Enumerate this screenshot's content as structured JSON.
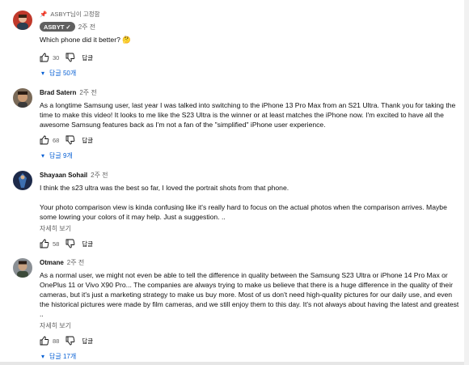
{
  "comments": [
    {
      "pinned_label": "ASBYT님이 고정함",
      "author": "ASBYT",
      "time": "2주 전",
      "text": "Which phone did it better? 🤔",
      "likes": "30",
      "reply_label": "답글",
      "replies_label": "답글 50개"
    },
    {
      "author": "Brad Satern",
      "time": "2주 전",
      "text": "As a longtime Samsung user, last year I was talked into switching to the iPhone 13 Pro Max from an S21 Ultra. Thank you for taking the time to make this video! It looks to me like the S23 Ultra is the winner or at least matches the iPhone now. I'm excited to have all the awesome Samsung features back as I'm not a fan of the \"simplified\" iPhone user experience.",
      "likes": "68",
      "reply_label": "답글",
      "replies_label": "답글 9개"
    },
    {
      "author": "Shayaan Sohail",
      "time": "2주 전",
      "text": "I think the s23 ultra was the best so far, I loved the portrait shots from that phone.\n\nYour photo comparison view is kinda confusing like it's really hard to focus on the actual photos when the comparison arrives. Maybe some lowring your colors of it may help. Just a suggestion. ..",
      "more_label": "자세히 보기",
      "likes": "58",
      "reply_label": "답글"
    },
    {
      "author": "Otmane",
      "time": "2주 전",
      "text": "As a normal user, we might not even be able to tell the difference in quality between the Samsung S23 Ultra or iPhone 14 Pro Max or OnePlus 11 or Vivo X90 Pro... The companies are always trying to make us believe that there is a huge difference in the quality of their cameras, but it's just a marketing strategy to make us buy more. Most of us don't need high-quality pictures for our daily use, and even the historical pictures were made by film cameras, and we still enjoy them to this day. It's not always about having the latest and greatest ..",
      "more_label": "자세히 보기",
      "likes": "88",
      "reply_label": "답글",
      "replies_label": "답글 17개"
    }
  ],
  "colors": {
    "link": "#065fd4",
    "secondary": "#606060"
  }
}
